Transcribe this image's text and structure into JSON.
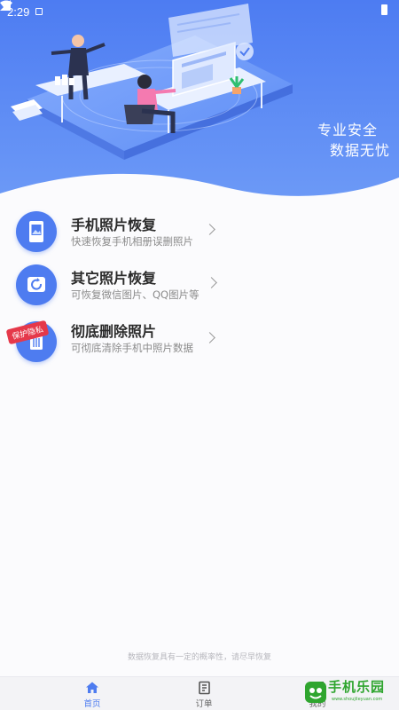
{
  "status_bar": {
    "time": "2:29"
  },
  "hero": {
    "slogan_line1": "专业安全",
    "slogan_line2": "数据无忧"
  },
  "menu": [
    {
      "icon": "phone-photo-icon",
      "title": "手机照片恢复",
      "subtitle": "快速恢复手机相册误删照片"
    },
    {
      "icon": "restore-icon",
      "title": "其它照片恢复",
      "subtitle": "可恢复微信图片、QQ图片等"
    },
    {
      "icon": "trash-icon",
      "title": "彻底删除照片",
      "subtitle": "可彻底清除手机中照片数据",
      "badge": "保护隐私"
    }
  ],
  "footnote": "数据恢复具有一定的概率性，请尽早恢复",
  "tabs": [
    {
      "label": "首页",
      "icon": "home-icon",
      "active": true
    },
    {
      "label": "订单",
      "icon": "order-icon",
      "active": false
    },
    {
      "label": "我的",
      "icon": "profile-icon",
      "active": false
    }
  ],
  "watermark": {
    "text": "手机乐园",
    "url": "www.shoujileyuan.com"
  },
  "colors": {
    "primary": "#4e7cf0",
    "badge": "#e5384a",
    "watermark": "#2fa52f"
  }
}
